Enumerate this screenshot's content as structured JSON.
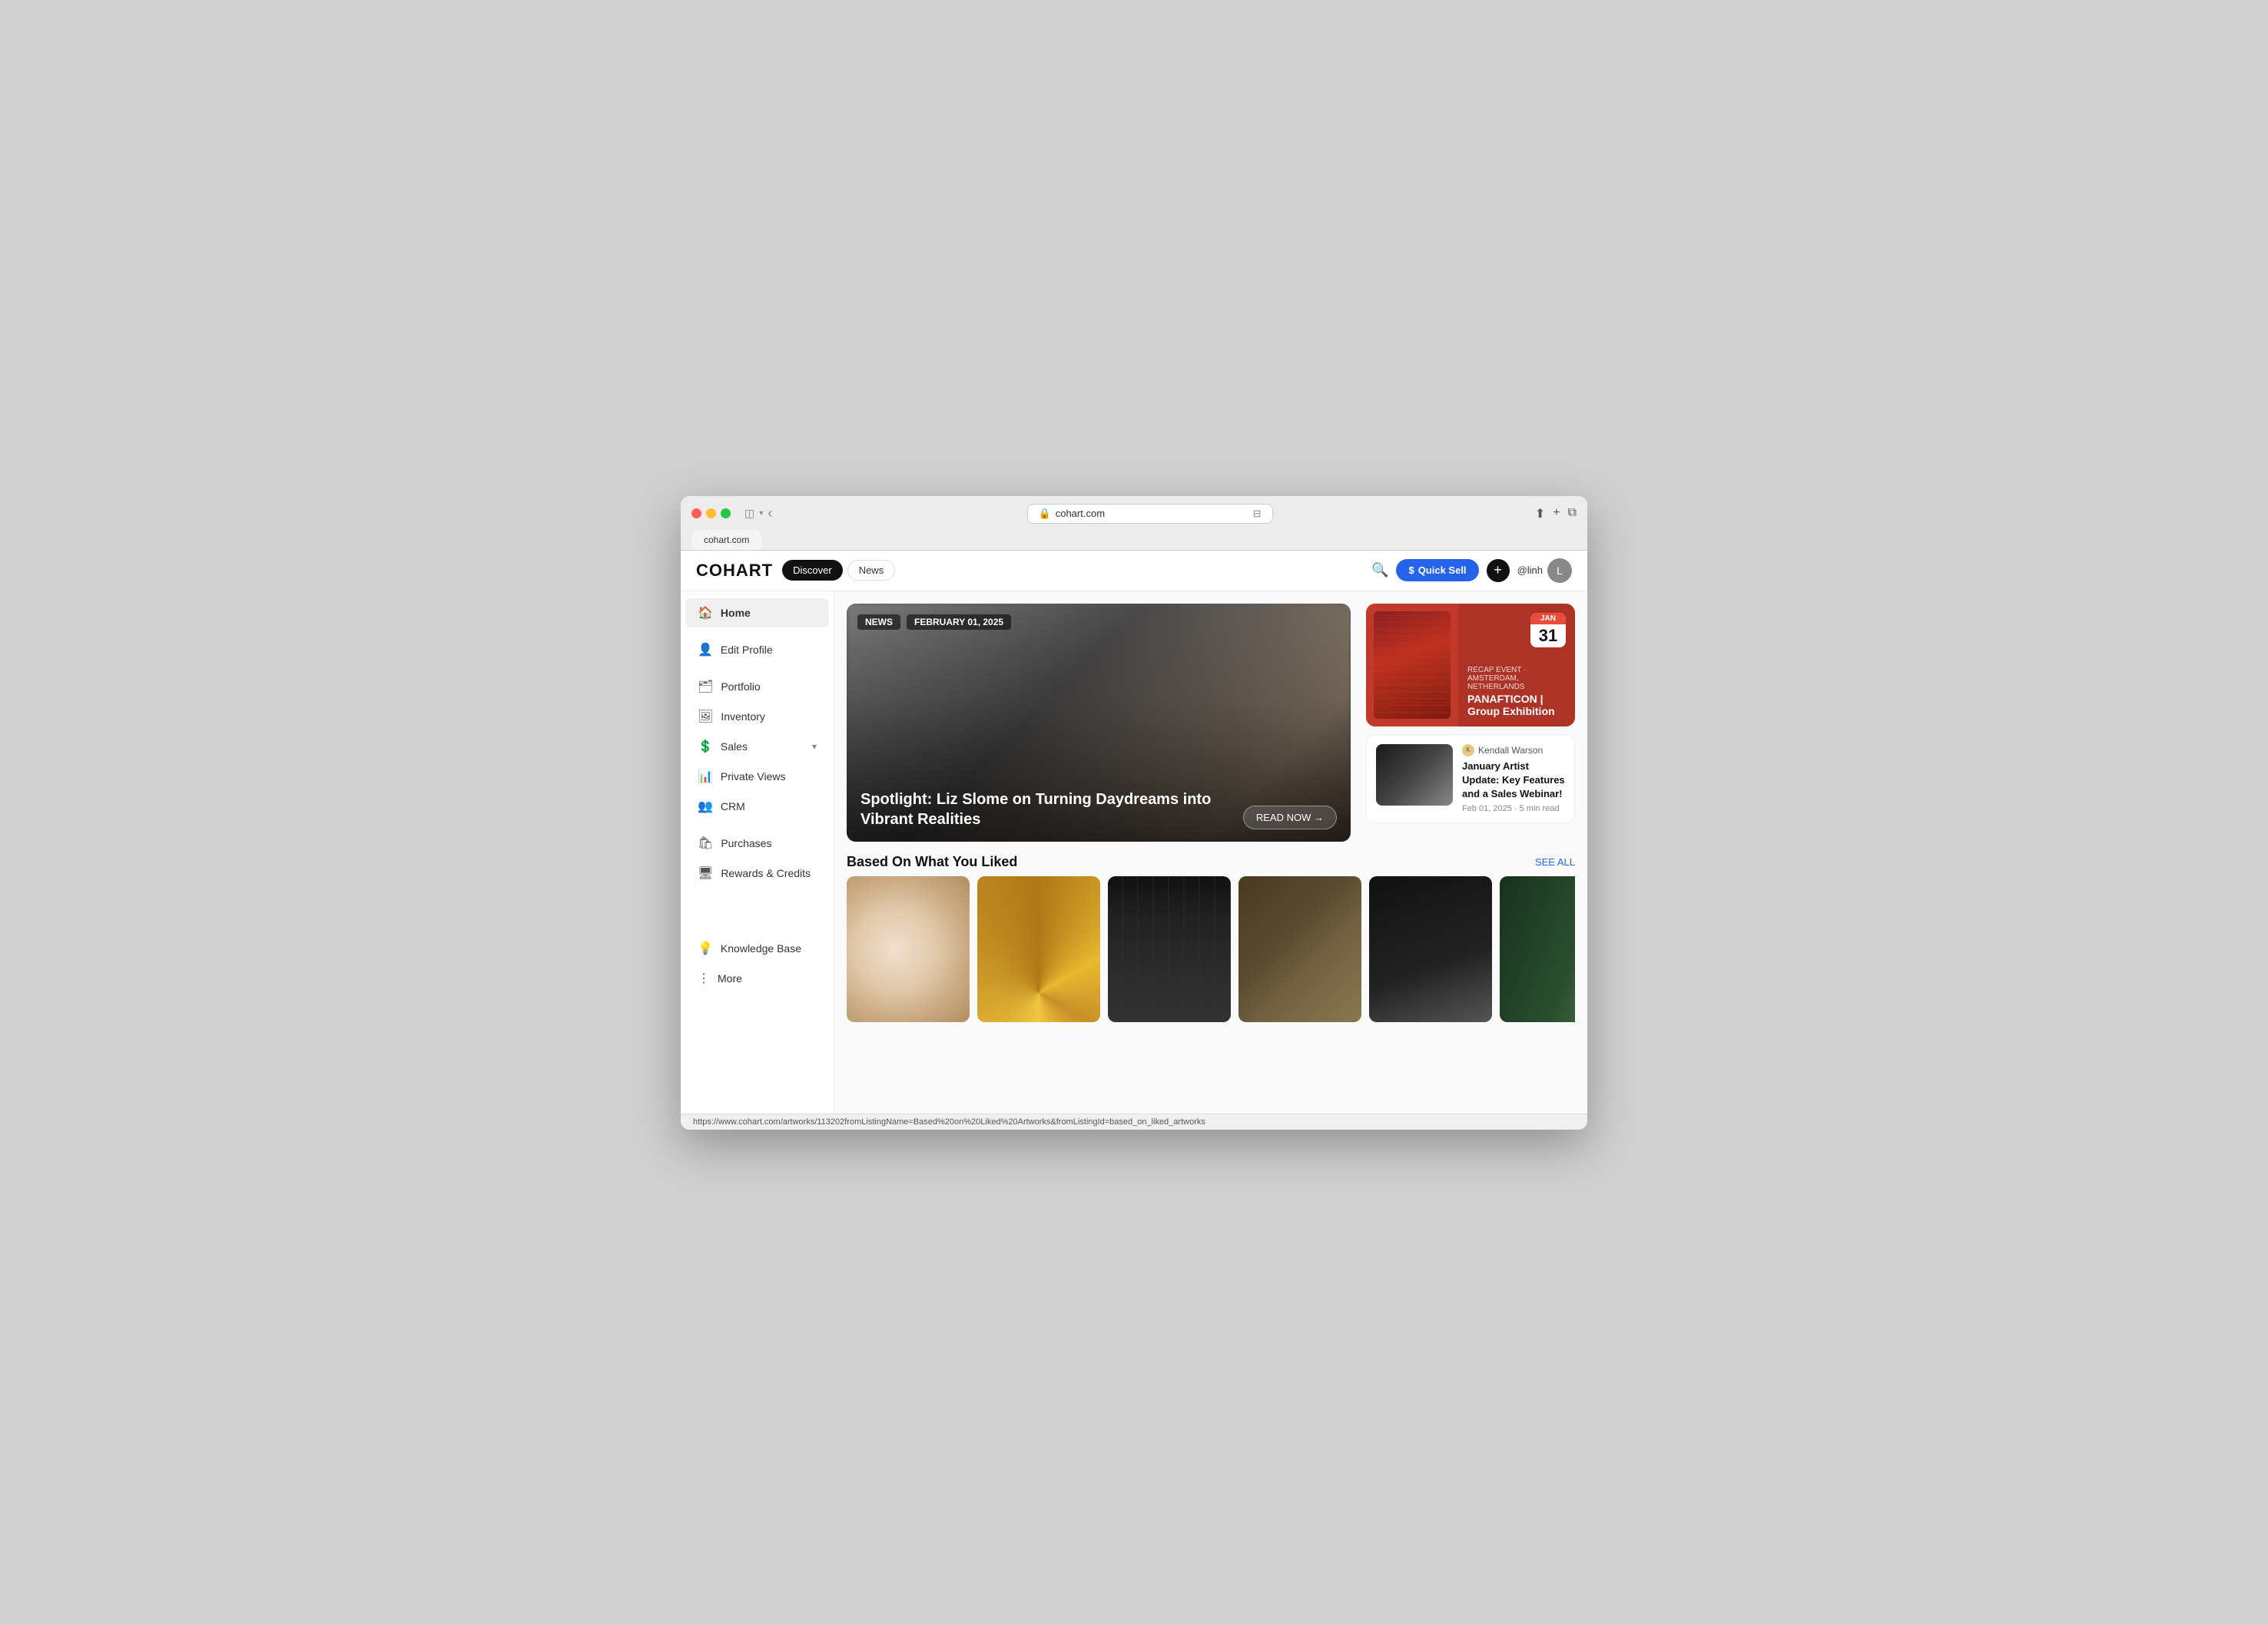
{
  "browser": {
    "url": "cohart.com",
    "tab_label": "cohart.com",
    "lock_icon": "🔒",
    "reader_icon": "⊟",
    "share_icon": "⬆",
    "newtab_icon": "+",
    "tabs_icon": "⧉",
    "back_icon": "‹",
    "sidebar_icon": "⊞"
  },
  "header": {
    "logo": "COHART",
    "nav": {
      "discover": "Discover",
      "news": "News"
    },
    "quick_sell": "Quick Sell",
    "quick_sell_icon": "$",
    "plus_icon": "+",
    "username": "@linh",
    "search_placeholder": "Search"
  },
  "sidebar": {
    "items": [
      {
        "id": "home",
        "label": "Home",
        "icon": "🏠",
        "active": true
      },
      {
        "id": "edit-profile",
        "label": "Edit Profile",
        "icon": "👤"
      },
      {
        "id": "portfolio",
        "label": "Portfolio",
        "icon": "🗂"
      },
      {
        "id": "inventory",
        "label": "Inventory",
        "icon": "🖼"
      },
      {
        "id": "sales",
        "label": "Sales",
        "icon": "💲",
        "expandable": true
      },
      {
        "id": "private-views",
        "label": "Private Views",
        "icon": "📊"
      },
      {
        "id": "crm",
        "label": "CRM",
        "icon": "👥"
      },
      {
        "id": "purchases",
        "label": "Purchases",
        "icon": "🛍"
      },
      {
        "id": "rewards-credits",
        "label": "Rewards & Credits",
        "icon": "🖥"
      }
    ],
    "bottom": [
      {
        "id": "knowledge-base",
        "label": "Knowledge Base",
        "icon": "💡"
      },
      {
        "id": "more",
        "label": "More",
        "icon": "⋮"
      }
    ]
  },
  "hero": {
    "tag1": "NEWS",
    "tag2": "FEBRUARY 01, 2025",
    "title": "Spotlight: Liz Slome on Turning Daydreams into Vibrant Realities",
    "read_now": "READ NOW →"
  },
  "event": {
    "type": "RECAP EVENT",
    "location": "AMSTERDAM, NETHERLANDS",
    "title": "PANAFTICON | Group Exhibition",
    "month": "JAN",
    "day": "31"
  },
  "article": {
    "author": "Kendall Warson",
    "title": "January Artist Update: Key Features and a Sales Webinar!",
    "date": "Feb 01, 2025 · 5 min read"
  },
  "section": {
    "liked_title": "Based On What You Liked",
    "see_all": "SEE ALL"
  },
  "status_bar": {
    "url": "https://www.cohart.com/artworks/113202fromListingName=Based%20on%20Liked%20Artworks&fromListingId=based_on_liked_artworks"
  }
}
